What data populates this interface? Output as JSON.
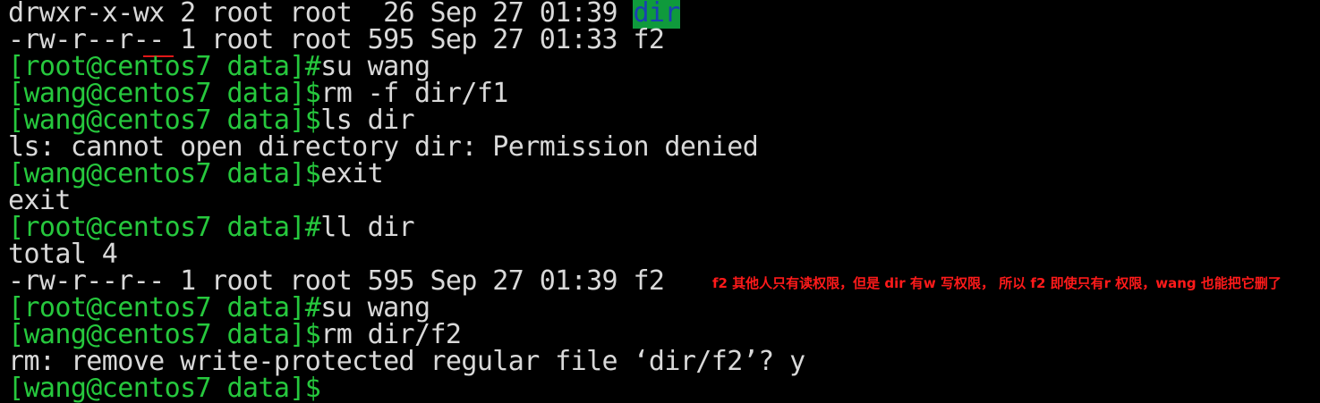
{
  "terminal": {
    "lines": [
      {
        "kind": "output",
        "text": "drwxr-x-wx 2 root root  26 Sep 27 01:39 ",
        "highlight": "dir"
      },
      {
        "kind": "output",
        "text": "-rw-r--r-- 1 root root 595 Sep 27 01:33 f2"
      },
      {
        "kind": "cmd",
        "prompt": "[root@centos7 data]#",
        "command": "su wang"
      },
      {
        "kind": "cmd",
        "prompt": "[wang@centos7 data]$",
        "command": "rm -f dir/f1"
      },
      {
        "kind": "cmd",
        "prompt": "[wang@centos7 data]$",
        "command": "ls dir"
      },
      {
        "kind": "output",
        "text": "ls: cannot open directory dir: Permission denied"
      },
      {
        "kind": "cmd",
        "prompt": "[wang@centos7 data]$",
        "command": "exit"
      },
      {
        "kind": "output",
        "text": "exit"
      },
      {
        "kind": "cmd",
        "prompt": "[root@centos7 data]#",
        "command": "ll dir"
      },
      {
        "kind": "output",
        "text": "total 4"
      },
      {
        "kind": "output",
        "text": "-rw-r--r-- 1 root root 595 Sep 27 01:39 f2"
      },
      {
        "kind": "cmd",
        "prompt": "[root@centos7 data]#",
        "command": "su wang"
      },
      {
        "kind": "cmd",
        "prompt": "[wang@centos7 data]$",
        "command": "rm dir/f2"
      },
      {
        "kind": "output",
        "text": "rm: remove write-protected regular file ‘dir/f2’? y"
      },
      {
        "kind": "cmd",
        "prompt": "[wang@centos7 data]$",
        "command": ""
      }
    ]
  },
  "annotation": {
    "text": "f2  其他人只有读权限，但是 dir 有w 写权限， 所以 f2 即使只有r 权限，wang 也能把它删了"
  },
  "colors": {
    "background": "#000000",
    "prompt": "#26c83d",
    "output": "#d9d9d9",
    "dir_highlight_bg": "#0f9a3c",
    "dir_highlight_fg": "#1a3fb3",
    "annotation": "#ff1a1a",
    "underline": "#e01818"
  }
}
